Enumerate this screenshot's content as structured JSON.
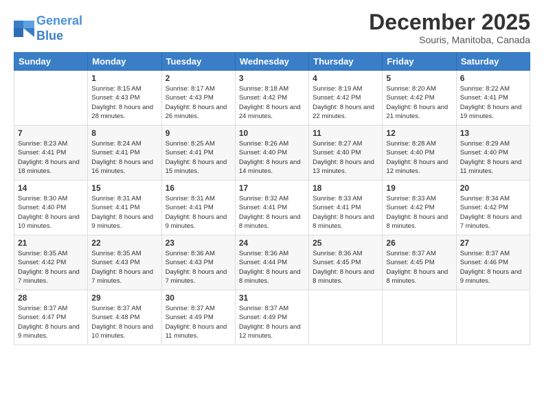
{
  "logo": {
    "line1": "General",
    "line2": "Blue"
  },
  "title": "December 2025",
  "location": "Souris, Manitoba, Canada",
  "headers": [
    "Sunday",
    "Monday",
    "Tuesday",
    "Wednesday",
    "Thursday",
    "Friday",
    "Saturday"
  ],
  "weeks": [
    [
      {
        "day": "",
        "sunrise": "",
        "sunset": "",
        "daylight": ""
      },
      {
        "day": "1",
        "sunrise": "Sunrise: 8:15 AM",
        "sunset": "Sunset: 4:43 PM",
        "daylight": "Daylight: 8 hours and 28 minutes."
      },
      {
        "day": "2",
        "sunrise": "Sunrise: 8:17 AM",
        "sunset": "Sunset: 4:43 PM",
        "daylight": "Daylight: 8 hours and 26 minutes."
      },
      {
        "day": "3",
        "sunrise": "Sunrise: 8:18 AM",
        "sunset": "Sunset: 4:42 PM",
        "daylight": "Daylight: 8 hours and 24 minutes."
      },
      {
        "day": "4",
        "sunrise": "Sunrise: 8:19 AM",
        "sunset": "Sunset: 4:42 PM",
        "daylight": "Daylight: 8 hours and 22 minutes."
      },
      {
        "day": "5",
        "sunrise": "Sunrise: 8:20 AM",
        "sunset": "Sunset: 4:42 PM",
        "daylight": "Daylight: 8 hours and 21 minutes."
      },
      {
        "day": "6",
        "sunrise": "Sunrise: 8:22 AM",
        "sunset": "Sunset: 4:41 PM",
        "daylight": "Daylight: 8 hours and 19 minutes."
      }
    ],
    [
      {
        "day": "7",
        "sunrise": "Sunrise: 8:23 AM",
        "sunset": "Sunset: 4:41 PM",
        "daylight": "Daylight: 8 hours and 18 minutes."
      },
      {
        "day": "8",
        "sunrise": "Sunrise: 8:24 AM",
        "sunset": "Sunset: 4:41 PM",
        "daylight": "Daylight: 8 hours and 16 minutes."
      },
      {
        "day": "9",
        "sunrise": "Sunrise: 8:25 AM",
        "sunset": "Sunset: 4:41 PM",
        "daylight": "Daylight: 8 hours and 15 minutes."
      },
      {
        "day": "10",
        "sunrise": "Sunrise: 8:26 AM",
        "sunset": "Sunset: 4:40 PM",
        "daylight": "Daylight: 8 hours and 14 minutes."
      },
      {
        "day": "11",
        "sunrise": "Sunrise: 8:27 AM",
        "sunset": "Sunset: 4:40 PM",
        "daylight": "Daylight: 8 hours and 13 minutes."
      },
      {
        "day": "12",
        "sunrise": "Sunrise: 8:28 AM",
        "sunset": "Sunset: 4:40 PM",
        "daylight": "Daylight: 8 hours and 12 minutes."
      },
      {
        "day": "13",
        "sunrise": "Sunrise: 8:29 AM",
        "sunset": "Sunset: 4:40 PM",
        "daylight": "Daylight: 8 hours and 11 minutes."
      }
    ],
    [
      {
        "day": "14",
        "sunrise": "Sunrise: 8:30 AM",
        "sunset": "Sunset: 4:40 PM",
        "daylight": "Daylight: 8 hours and 10 minutes."
      },
      {
        "day": "15",
        "sunrise": "Sunrise: 8:31 AM",
        "sunset": "Sunset: 4:41 PM",
        "daylight": "Daylight: 8 hours and 9 minutes."
      },
      {
        "day": "16",
        "sunrise": "Sunrise: 8:31 AM",
        "sunset": "Sunset: 4:41 PM",
        "daylight": "Daylight: 8 hours and 9 minutes."
      },
      {
        "day": "17",
        "sunrise": "Sunrise: 8:32 AM",
        "sunset": "Sunset: 4:41 PM",
        "daylight": "Daylight: 8 hours and 8 minutes."
      },
      {
        "day": "18",
        "sunrise": "Sunrise: 8:33 AM",
        "sunset": "Sunset: 4:41 PM",
        "daylight": "Daylight: 8 hours and 8 minutes."
      },
      {
        "day": "19",
        "sunrise": "Sunrise: 8:33 AM",
        "sunset": "Sunset: 4:42 PM",
        "daylight": "Daylight: 8 hours and 8 minutes."
      },
      {
        "day": "20",
        "sunrise": "Sunrise: 8:34 AM",
        "sunset": "Sunset: 4:42 PM",
        "daylight": "Daylight: 8 hours and 7 minutes."
      }
    ],
    [
      {
        "day": "21",
        "sunrise": "Sunrise: 8:35 AM",
        "sunset": "Sunset: 4:42 PM",
        "daylight": "Daylight: 8 hours and 7 minutes."
      },
      {
        "day": "22",
        "sunrise": "Sunrise: 8:35 AM",
        "sunset": "Sunset: 4:43 PM",
        "daylight": "Daylight: 8 hours and 7 minutes."
      },
      {
        "day": "23",
        "sunrise": "Sunrise: 8:36 AM",
        "sunset": "Sunset: 4:43 PM",
        "daylight": "Daylight: 8 hours and 7 minutes."
      },
      {
        "day": "24",
        "sunrise": "Sunrise: 8:36 AM",
        "sunset": "Sunset: 4:44 PM",
        "daylight": "Daylight: 8 hours and 8 minutes."
      },
      {
        "day": "25",
        "sunrise": "Sunrise: 8:36 AM",
        "sunset": "Sunset: 4:45 PM",
        "daylight": "Daylight: 8 hours and 8 minutes."
      },
      {
        "day": "26",
        "sunrise": "Sunrise: 8:37 AM",
        "sunset": "Sunset: 4:45 PM",
        "daylight": "Daylight: 8 hours and 8 minutes."
      },
      {
        "day": "27",
        "sunrise": "Sunrise: 8:37 AM",
        "sunset": "Sunset: 4:46 PM",
        "daylight": "Daylight: 8 hours and 9 minutes."
      }
    ],
    [
      {
        "day": "28",
        "sunrise": "Sunrise: 8:37 AM",
        "sunset": "Sunset: 4:47 PM",
        "daylight": "Daylight: 8 hours and 9 minutes."
      },
      {
        "day": "29",
        "sunrise": "Sunrise: 8:37 AM",
        "sunset": "Sunset: 4:48 PM",
        "daylight": "Daylight: 8 hours and 10 minutes."
      },
      {
        "day": "30",
        "sunrise": "Sunrise: 8:37 AM",
        "sunset": "Sunset: 4:49 PM",
        "daylight": "Daylight: 8 hours and 11 minutes."
      },
      {
        "day": "31",
        "sunrise": "Sunrise: 8:37 AM",
        "sunset": "Sunset: 4:49 PM",
        "daylight": "Daylight: 8 hours and 12 minutes."
      },
      {
        "day": "",
        "sunrise": "",
        "sunset": "",
        "daylight": ""
      },
      {
        "day": "",
        "sunrise": "",
        "sunset": "",
        "daylight": ""
      },
      {
        "day": "",
        "sunrise": "",
        "sunset": "",
        "daylight": ""
      }
    ]
  ]
}
